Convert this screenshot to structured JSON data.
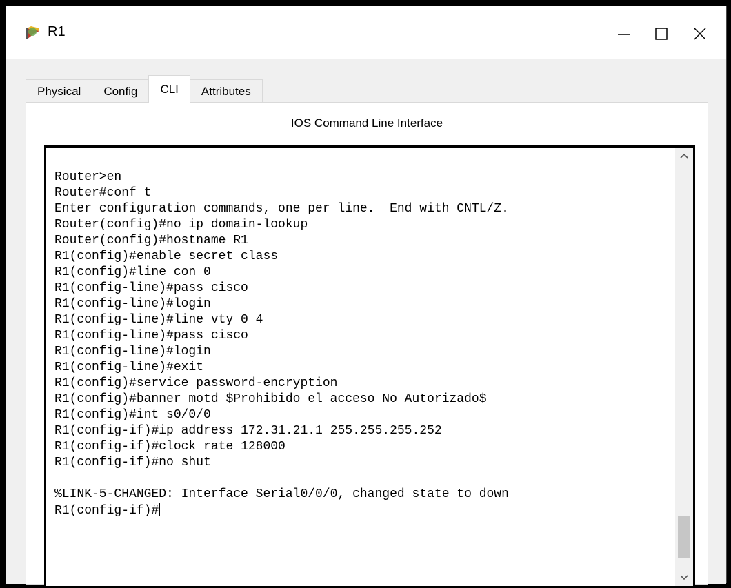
{
  "window": {
    "title": "R1",
    "app_icon": "router-icon",
    "controls": {
      "minimize": "minimize-icon",
      "maximize": "maximize-icon",
      "close": "close-icon"
    }
  },
  "tabs": [
    {
      "label": "Physical",
      "active": false
    },
    {
      "label": "Config",
      "active": false
    },
    {
      "label": "CLI",
      "active": true
    },
    {
      "label": "Attributes",
      "active": false
    }
  ],
  "cli": {
    "heading": "IOS Command Line Interface",
    "lines": [
      "Router>en",
      "Router#conf t",
      "Enter configuration commands, one per line.  End with CNTL/Z.",
      "Router(config)#no ip domain-lookup",
      "Router(config)#hostname R1",
      "R1(config)#enable secret class",
      "R1(config)#line con 0",
      "R1(config-line)#pass cisco",
      "R1(config-line)#login",
      "R1(config-line)#line vty 0 4",
      "R1(config-line)#pass cisco",
      "R1(config-line)#login",
      "R1(config-line)#exit",
      "R1(config)#service password-encryption",
      "R1(config)#banner motd $Prohibido el acceso No Autorizado$",
      "R1(config)#int s0/0/0",
      "R1(config-if)#ip address 172.31.21.1 255.255.255.252",
      "R1(config-if)#clock rate 128000",
      "R1(config-if)#no shut",
      "",
      "%LINK-5-CHANGED: Interface Serial0/0/0, changed state to down",
      "R1(config-if)#"
    ],
    "scroll_position": 0.92
  }
}
